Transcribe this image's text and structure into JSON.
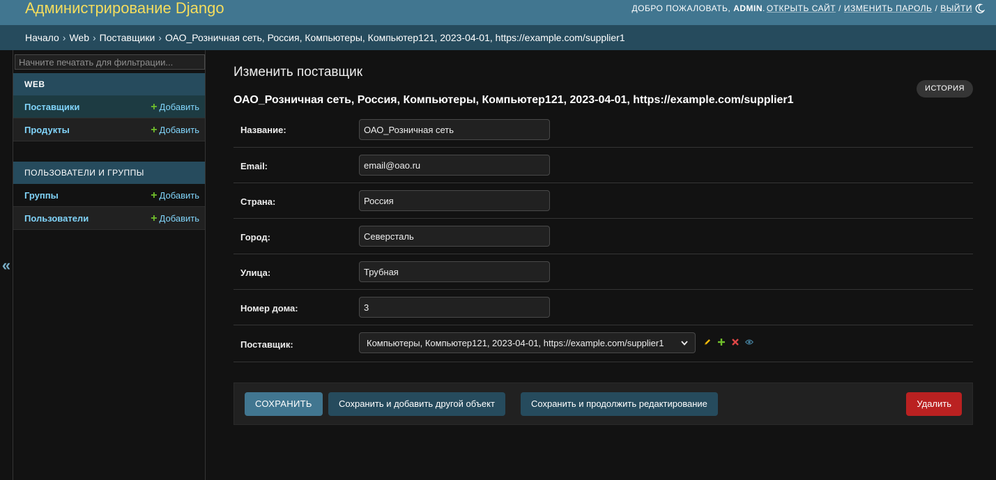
{
  "header": {
    "site_name": "Администрирование Django",
    "welcome": "Добро пожаловать,",
    "username": "admin",
    "dot": ".",
    "view_site": "Открыть сайт",
    "sep": "/",
    "change_password": "Изменить пароль",
    "logout": "Выйти",
    "theme_icon": "moon-icon"
  },
  "breadcrumbs": {
    "items": [
      "Начало",
      "Web",
      "Поставщики",
      "ОАО_Розничная сеть, Россия, Компьютеры, Компьютер121, 2023-04-01, https://example.com/supplier1"
    ],
    "separator": "›"
  },
  "sidebar": {
    "toggle": "«",
    "filter_placeholder": "Начните печатать для фильтрации...",
    "modules": [
      {
        "caption": "Web",
        "models": [
          {
            "name": "Поставщики",
            "add": "Добавить",
            "current": true
          },
          {
            "name": "Продукты",
            "add": "Добавить",
            "current": false
          }
        ]
      },
      {
        "caption": "Пользователи и группы",
        "models": [
          {
            "name": "Группы",
            "add": "Добавить",
            "current": false
          },
          {
            "name": "Пользователи",
            "add": "Добавить",
            "current": false
          }
        ]
      }
    ]
  },
  "main": {
    "page_title": "Изменить поставщик",
    "object_title": "ОАО_Розничная сеть, Россия, Компьютеры, Компьютер121, 2023-04-01, https://example.com/supplier1",
    "history_label": "История",
    "fields": [
      {
        "label": "Название:",
        "value": "ОАО_Розничная сеть"
      },
      {
        "label": "Email:",
        "value": "email@oao.ru"
      },
      {
        "label": "Страна:",
        "value": "Россия"
      },
      {
        "label": "Город:",
        "value": "Северсталь"
      },
      {
        "label": "Улица:",
        "value": "Трубная"
      },
      {
        "label": "Номер дома:",
        "value": "3"
      }
    ],
    "supplier_field": {
      "label": "Поставщик:",
      "selected": "Компьютеры, Компьютер121, 2023-04-01, https://example.com/supplier1",
      "icons": [
        "pencil-icon",
        "plus-icon",
        "delete-x-icon",
        "eye-icon"
      ]
    },
    "buttons": {
      "save": "Сохранить",
      "save_add": "Сохранить и добавить другой объект",
      "save_continue": "Сохранить и продолжить редактирование",
      "delete": "Удалить"
    }
  },
  "colors": {
    "header_bg": "#417690",
    "breadcrumbs_bg": "#264b5d",
    "site_name": "#f5dd5d",
    "link": "#81d4fa",
    "add_plus": "#70bf2b",
    "delete": "#ba2121"
  }
}
